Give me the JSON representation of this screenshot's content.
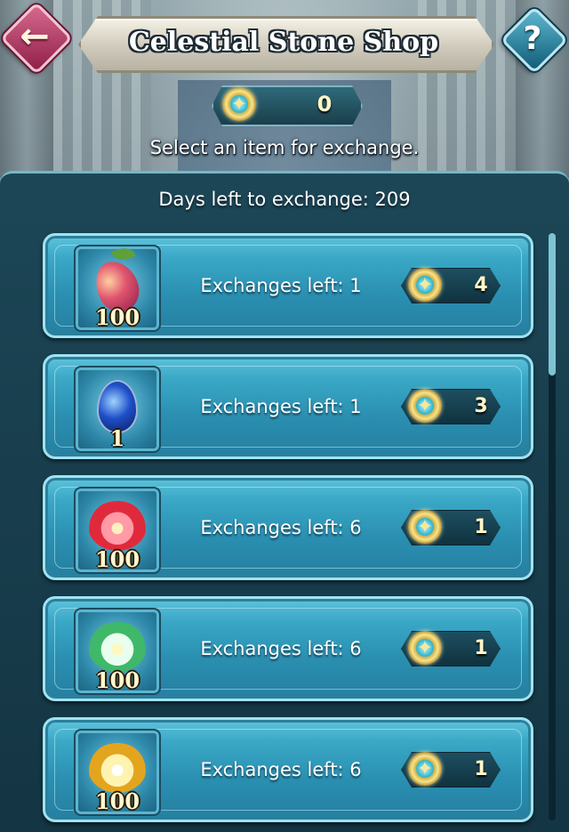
{
  "header": {
    "title": "Celestial Stone Shop",
    "back_icon": "arrow-left",
    "help_label": "?"
  },
  "currency": {
    "icon": "celestial-stone",
    "amount": "0"
  },
  "instruction": "Select an item for exchange.",
  "days_left": "Days left to exchange: 209",
  "items": [
    {
      "art": "fruit",
      "quantity": "100",
      "exchanges": "Exchanges left: 1",
      "cost": "4"
    },
    {
      "art": "egg",
      "quantity": "1",
      "exchanges": "Exchanges left: 1",
      "cost": "3"
    },
    {
      "art": "red-flower",
      "quantity": "100",
      "exchanges": "Exchanges left: 6",
      "cost": "1"
    },
    {
      "art": "green-flower",
      "quantity": "100",
      "exchanges": "Exchanges left: 6",
      "cost": "1"
    },
    {
      "art": "gold-flower",
      "quantity": "100",
      "exchanges": "Exchanges left: 6",
      "cost": "1"
    }
  ],
  "colors": {
    "panel": "#1c4656",
    "row": "#3aa8c6",
    "back_button": "#b63a63",
    "help_button": "#1f8aa8"
  }
}
